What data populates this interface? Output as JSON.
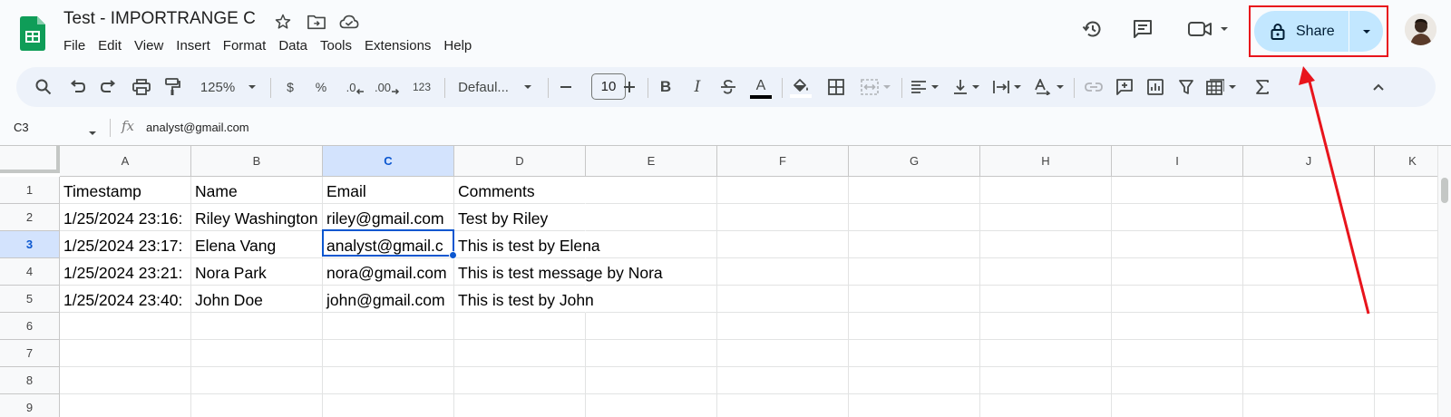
{
  "doc": {
    "title": "Test - IMPORTRANGE C",
    "icons": [
      "star-icon",
      "move-to-folder-icon",
      "cloud-saved-icon"
    ]
  },
  "menu": [
    "File",
    "Edit",
    "View",
    "Insert",
    "Format",
    "Data",
    "Tools",
    "Extensions",
    "Help"
  ],
  "header_actions": {
    "icons": [
      "version-history-icon",
      "comments-icon",
      "meet-icon"
    ],
    "share_label": "Share"
  },
  "toolbar": {
    "zoom": "125%",
    "currency": "$",
    "percent": "%",
    "decrease_decimal": ".0",
    "increase_decimal": ".00",
    "number_format": "123",
    "font": "Defaul...",
    "font_size": "10",
    "bold": "B",
    "italic": "I",
    "text_color": "A"
  },
  "formula_bar": {
    "cell_ref": "C3",
    "fx": "fx",
    "value": "analyst@gmail.com"
  },
  "sheet": {
    "columns": [
      "A",
      "B",
      "C",
      "D",
      "E",
      "F",
      "G",
      "H",
      "I",
      "J",
      "K"
    ],
    "row_numbers": [
      "1",
      "2",
      "3",
      "4",
      "5",
      "6",
      "7",
      "8",
      "9"
    ],
    "selected_cell": "C3",
    "rows": [
      [
        "Timestamp",
        "Name",
        "Email",
        "Comments"
      ],
      [
        "1/25/2024 23:16:",
        "Riley Washington",
        "riley@gmail.com",
        "Test by Riley"
      ],
      [
        "1/25/2024 23:17:",
        "Elena Vang",
        "analyst@gmail.c",
        "This is test by Elena"
      ],
      [
        "1/25/2024 23:21:",
        "Nora Park",
        "nora@gmail.com",
        "This is test message by Nora"
      ],
      [
        "1/25/2024 23:40:",
        "John Doe",
        "john@gmail.com",
        "This is test by John"
      ]
    ]
  },
  "colors": {
    "accent": "#0b57d0",
    "share_bg": "#c2e7ff",
    "annotation": "#e8141c",
    "sheets_green": "#0f9d58"
  }
}
